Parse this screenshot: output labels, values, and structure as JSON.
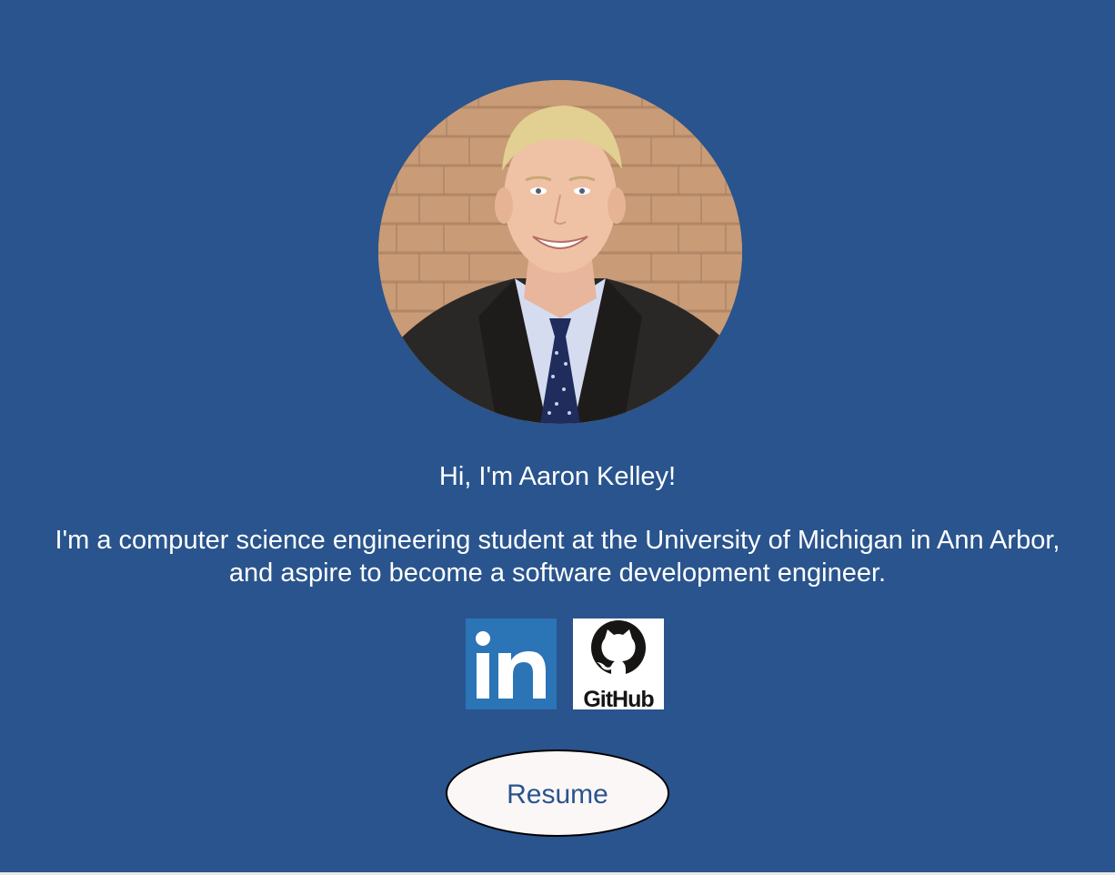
{
  "profile": {
    "photo_alt": "Aaron Kelley headshot",
    "greeting": "Hi, I'm Aaron Kelley!",
    "bio": "I'm a computer science engineering student at the University of Michigan in Ann Arbor, and aspire to become a software development engineer."
  },
  "social": {
    "linkedin_text": "in",
    "github_text": "GitHub"
  },
  "resume": {
    "label": "Resume"
  },
  "colors": {
    "background": "#29548d",
    "linkedin_blue": "#2b74b6",
    "button_fill": "#fcf7f7",
    "button_text": "#29548d"
  }
}
